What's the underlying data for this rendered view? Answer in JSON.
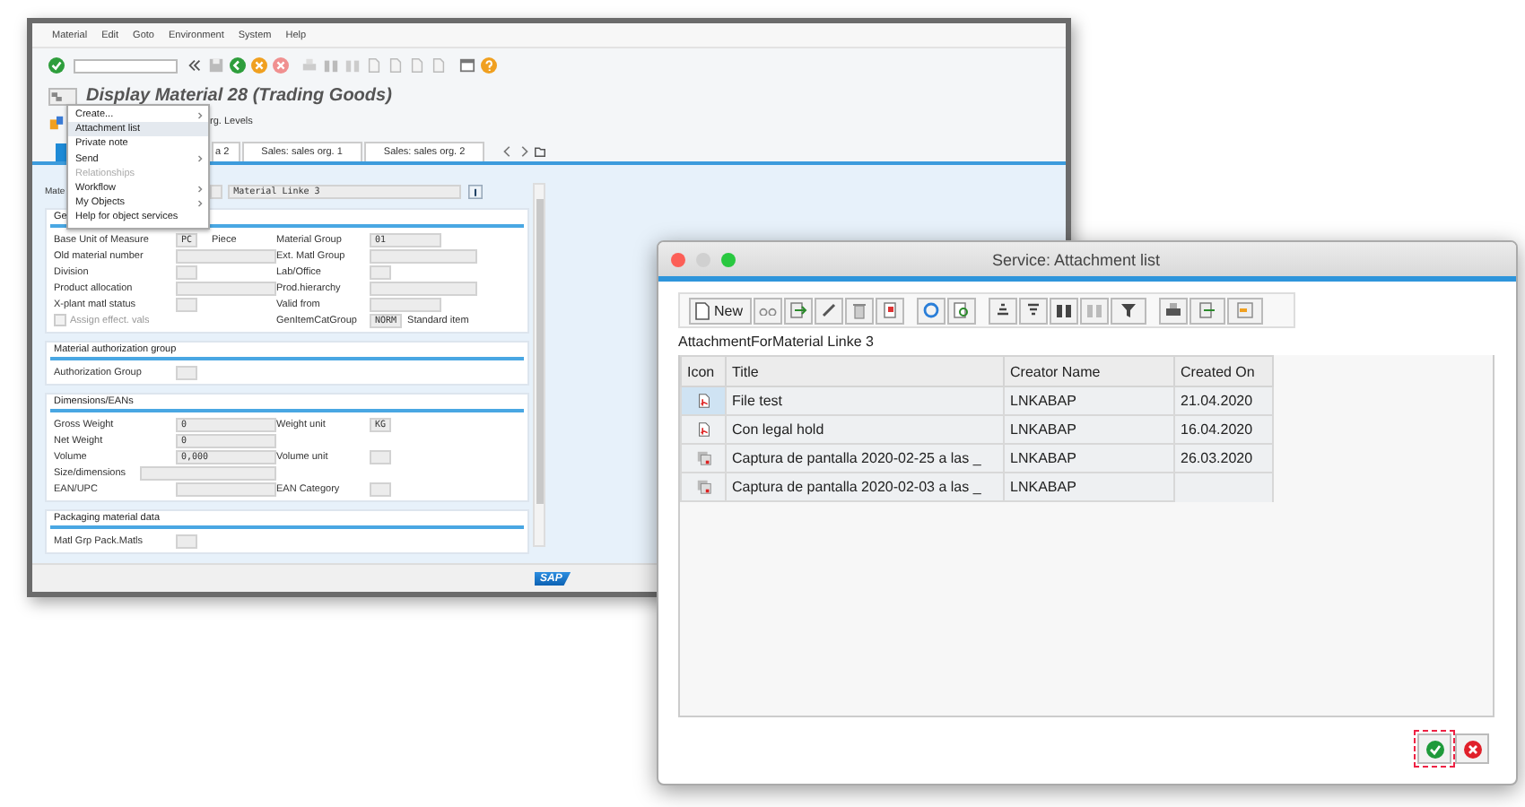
{
  "main_window": {
    "menu_bar": [
      "Material",
      "Edit",
      "Goto",
      "Environment",
      "System",
      "Help"
    ],
    "title": "Display Material 28 (Trading Goods)",
    "toolbar_text": "rg. Levels",
    "tabs": [
      {
        "selected": true
      },
      {
        "label": "a 2",
        "selected": false
      },
      {
        "label": "Sales: sales org. 1",
        "selected": false
      },
      {
        "label": "Sales: sales org. 2",
        "selected": false
      }
    ],
    "material": {
      "label": "Mate",
      "description": "Material Linke 3"
    },
    "sections": [
      {
        "title": "Ge",
        "rows": [
          {
            "cells": [
              {
                "kind": "short_field",
                "label": "Base Unit of Measure",
                "value": "PC",
                "text": "Piece"
              },
              {
                "kind": "mid_field",
                "label": "Material Group",
                "value": "01"
              }
            ]
          },
          {
            "cells": [
              {
                "kind": "long_field",
                "label": "Old material number"
              },
              {
                "kind": "long_field",
                "label": "Ext. Matl Group"
              }
            ]
          },
          {
            "cells": [
              {
                "kind": "short_field",
                "label": "Division"
              },
              {
                "kind": "short_field",
                "label": "Lab/Office"
              }
            ]
          },
          {
            "cells": [
              {
                "kind": "long_field",
                "label": "Product allocation"
              },
              {
                "kind": "long_field",
                "label": "Prod.hierarchy"
              }
            ]
          },
          {
            "cells": [
              {
                "kind": "short_field",
                "label": "X-plant matl status"
              },
              {
                "kind": "mid_field",
                "label": "Valid from"
              }
            ]
          },
          {
            "cells": [
              {
                "kind": "checkbox",
                "label": "Assign effect. vals",
                "checked": false,
                "disabled": true
              },
              {
                "kind": "short_field",
                "label": "GenItemCatGroup",
                "value": "NORM",
                "text": "Standard item"
              }
            ]
          }
        ]
      },
      {
        "title": "Material authorization group",
        "rows": [
          {
            "cells": [
              {
                "kind": "short_field",
                "label": "Authorization Group"
              }
            ]
          }
        ]
      },
      {
        "title": "Dimensions/EANs",
        "rows": [
          {
            "cells": [
              {
                "kind": "long_field",
                "label": "Gross Weight",
                "value": "0"
              },
              {
                "kind": "short_field",
                "label": "Weight unit",
                "value": "KG"
              }
            ]
          },
          {
            "cells": [
              {
                "kind": "long_field",
                "label": "Net Weight",
                "value": "0"
              }
            ]
          },
          {
            "cells": [
              {
                "kind": "long_field",
                "label": "Volume",
                "value": "0,000"
              },
              {
                "kind": "short_field",
                "label": "Volume unit"
              }
            ]
          },
          {
            "cells": [
              {
                "kind": "wide_field",
                "label": "Size/dimensions"
              }
            ]
          },
          {
            "cells": [
              {
                "kind": "long_field",
                "label": "EAN/UPC"
              },
              {
                "kind": "short_field",
                "label": "EAN Category"
              }
            ]
          }
        ]
      },
      {
        "title": "Packaging material data",
        "rows": [
          {
            "cells": [
              {
                "kind": "short_field",
                "label": "Matl Grp Pack.Matls"
              }
            ]
          }
        ]
      }
    ],
    "context_menu": [
      {
        "label": "Create...",
        "submenu": true,
        "disabled": false,
        "selected": false
      },
      {
        "label": "Attachment list",
        "submenu": false,
        "disabled": false,
        "selected": true
      },
      {
        "label": "Private note",
        "submenu": false,
        "disabled": false,
        "selected": false
      },
      {
        "label": "Send",
        "submenu": true,
        "disabled": false,
        "selected": false
      },
      {
        "label": "Relationships",
        "submenu": false,
        "disabled": true,
        "selected": false
      },
      {
        "label": "Workflow",
        "submenu": true,
        "disabled": false,
        "selected": false
      },
      {
        "label": "My Objects",
        "submenu": true,
        "disabled": false,
        "selected": false
      },
      {
        "label": "Help for object services",
        "submenu": false,
        "disabled": false,
        "selected": false
      }
    ],
    "status_bar": {
      "logo": "SAP"
    }
  },
  "dialog": {
    "title": "Service: Attachment list",
    "new_button": "New",
    "caption": "AttachmentForMaterial Linke 3",
    "columns": [
      "Icon",
      "Title",
      "Creator Name",
      "Created On"
    ],
    "rows": [
      {
        "kind": "pdf",
        "title": "File test",
        "creator": "LNKABAP",
        "created_on": "21.04.2020",
        "selected": true
      },
      {
        "kind": "pdf",
        "title": "Con legal hold",
        "creator": "LNKABAP",
        "created_on": "16.04.2020",
        "selected": false
      },
      {
        "kind": "image",
        "title": "Captura de pantalla 2020-02-25 a las _",
        "creator": "LNKABAP",
        "created_on": "26.03.2020",
        "selected": false
      },
      {
        "kind": "image",
        "title": "Captura de pantalla 2020-02-03 a las _",
        "creator": "LNKABAP",
        "selected": false
      }
    ]
  }
}
